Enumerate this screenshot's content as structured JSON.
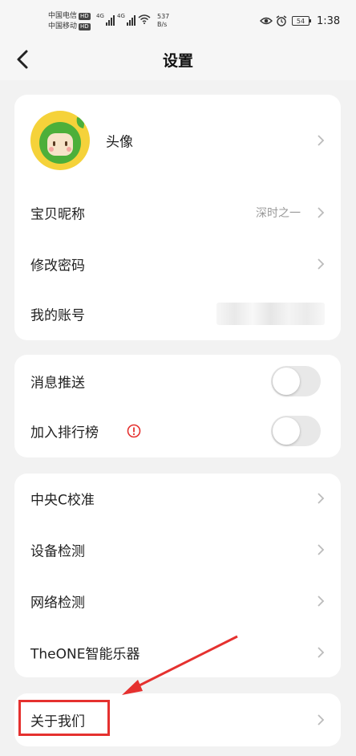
{
  "status_bar": {
    "carrier1": "中国电信",
    "carrier2": "中国移动",
    "hd_badge": "HD",
    "network": "4G",
    "speed_value": "537",
    "speed_unit": "B/s",
    "battery": "54",
    "time": "1:38"
  },
  "header": {
    "title": "设置"
  },
  "profile_card": {
    "avatar_label": "头像",
    "nickname_label": "宝贝昵称",
    "nickname_value": "深时之一",
    "password_label": "修改密码",
    "account_label": "我的账号"
  },
  "toggles_card": {
    "push_label": "消息推送",
    "push_enabled": false,
    "leaderboard_label": "加入排行榜",
    "leaderboard_enabled": false
  },
  "tools_card": {
    "items": [
      "中央C校准",
      "设备检测",
      "网络检测",
      "TheONE智能乐器"
    ]
  },
  "about_card": {
    "about_label": "关于我们"
  },
  "colors": {
    "annotation_red": "#e5312f",
    "avatar_yellow": "#f5d23a",
    "avatar_green": "#4caf3a"
  }
}
